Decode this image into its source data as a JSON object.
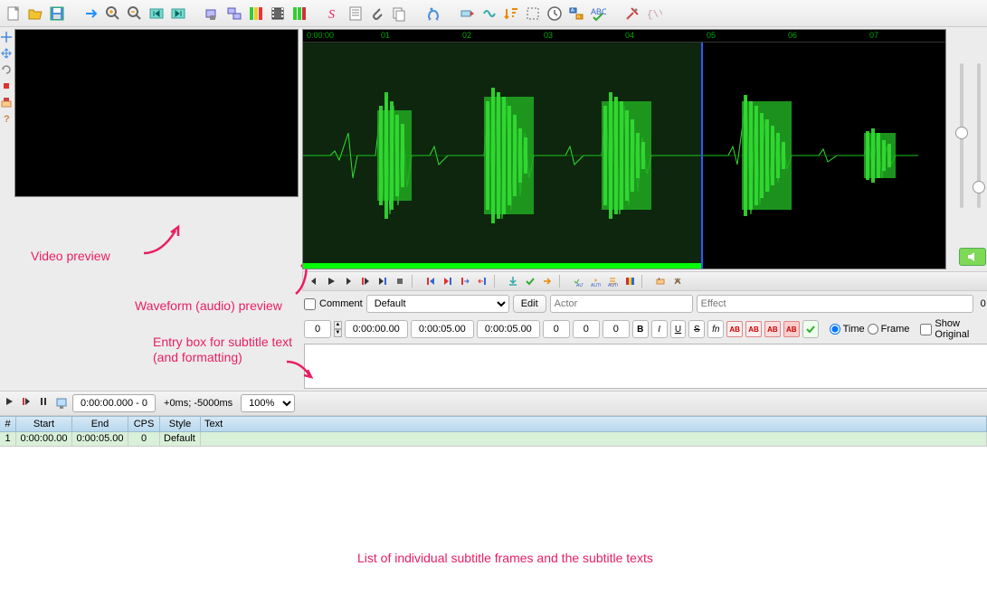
{
  "toolbar_icons": [
    "new",
    "open",
    "save",
    "sep",
    "redo-arrow",
    "zoom-in",
    "zoom-out",
    "jump-start",
    "jump-end",
    "sep",
    "video-open",
    "video-detach",
    "timing",
    "spectrum",
    "timing2",
    "sep",
    "style-manager",
    "properties",
    "attach",
    "copy",
    "sep",
    "automation",
    "sep",
    "shift-times",
    "resample",
    "sort",
    "select",
    "timing-post",
    "keyframe",
    "spellcheck",
    "sep",
    "tools",
    "macro"
  ],
  "left_tool_icons": [
    "crosshair",
    "move",
    "rotate",
    "record",
    "scale",
    "help"
  ],
  "annotations": {
    "video": "Video preview",
    "waveform": "Waveform (audio) preview",
    "entry1": "Entry box for subtitle text",
    "entry2": "(and formatting)",
    "grid": "List of individual subtitle frames and the subtitle texts"
  },
  "ruler": {
    "start": "0:00:00",
    "ticks": [
      "01",
      "02",
      "03",
      "04",
      "05",
      "06",
      "07"
    ]
  },
  "waveform_controls": [
    "prev",
    "play",
    "next",
    "play-start",
    "play-end",
    "stop",
    "sep",
    "lead-in",
    "lead-out",
    "snap-start",
    "snap-end",
    "sep",
    "commit-stay",
    "commit",
    "sep",
    "auto-commit",
    "auto-next",
    "auto-scroll",
    "spectrum",
    "sep",
    "karaoke",
    "split"
  ],
  "edit": {
    "comment_label": "Comment",
    "style_default": "Default",
    "edit_btn": "Edit",
    "actor_ph": "Actor",
    "effect_ph": "Effect",
    "layer_end": "0",
    "layer": "0",
    "start": "0:00:00.00",
    "end": "0:00:05.00",
    "dur": "0:00:05.00",
    "mL": "0",
    "mR": "0",
    "mV": "0",
    "time_label": "Time",
    "frame_label": "Frame",
    "show_orig": "Show Original"
  },
  "play_ctrl": {
    "time": "0:00:00.000 - 0",
    "offset": "+0ms; -5000ms",
    "zoom": "100%"
  },
  "grid": {
    "headers": [
      "#",
      "Start",
      "End",
      "CPS",
      "Style",
      "Text"
    ],
    "row": [
      "1",
      "0:00:00.00",
      "0:00:05.00",
      "0",
      "Default",
      ""
    ]
  }
}
